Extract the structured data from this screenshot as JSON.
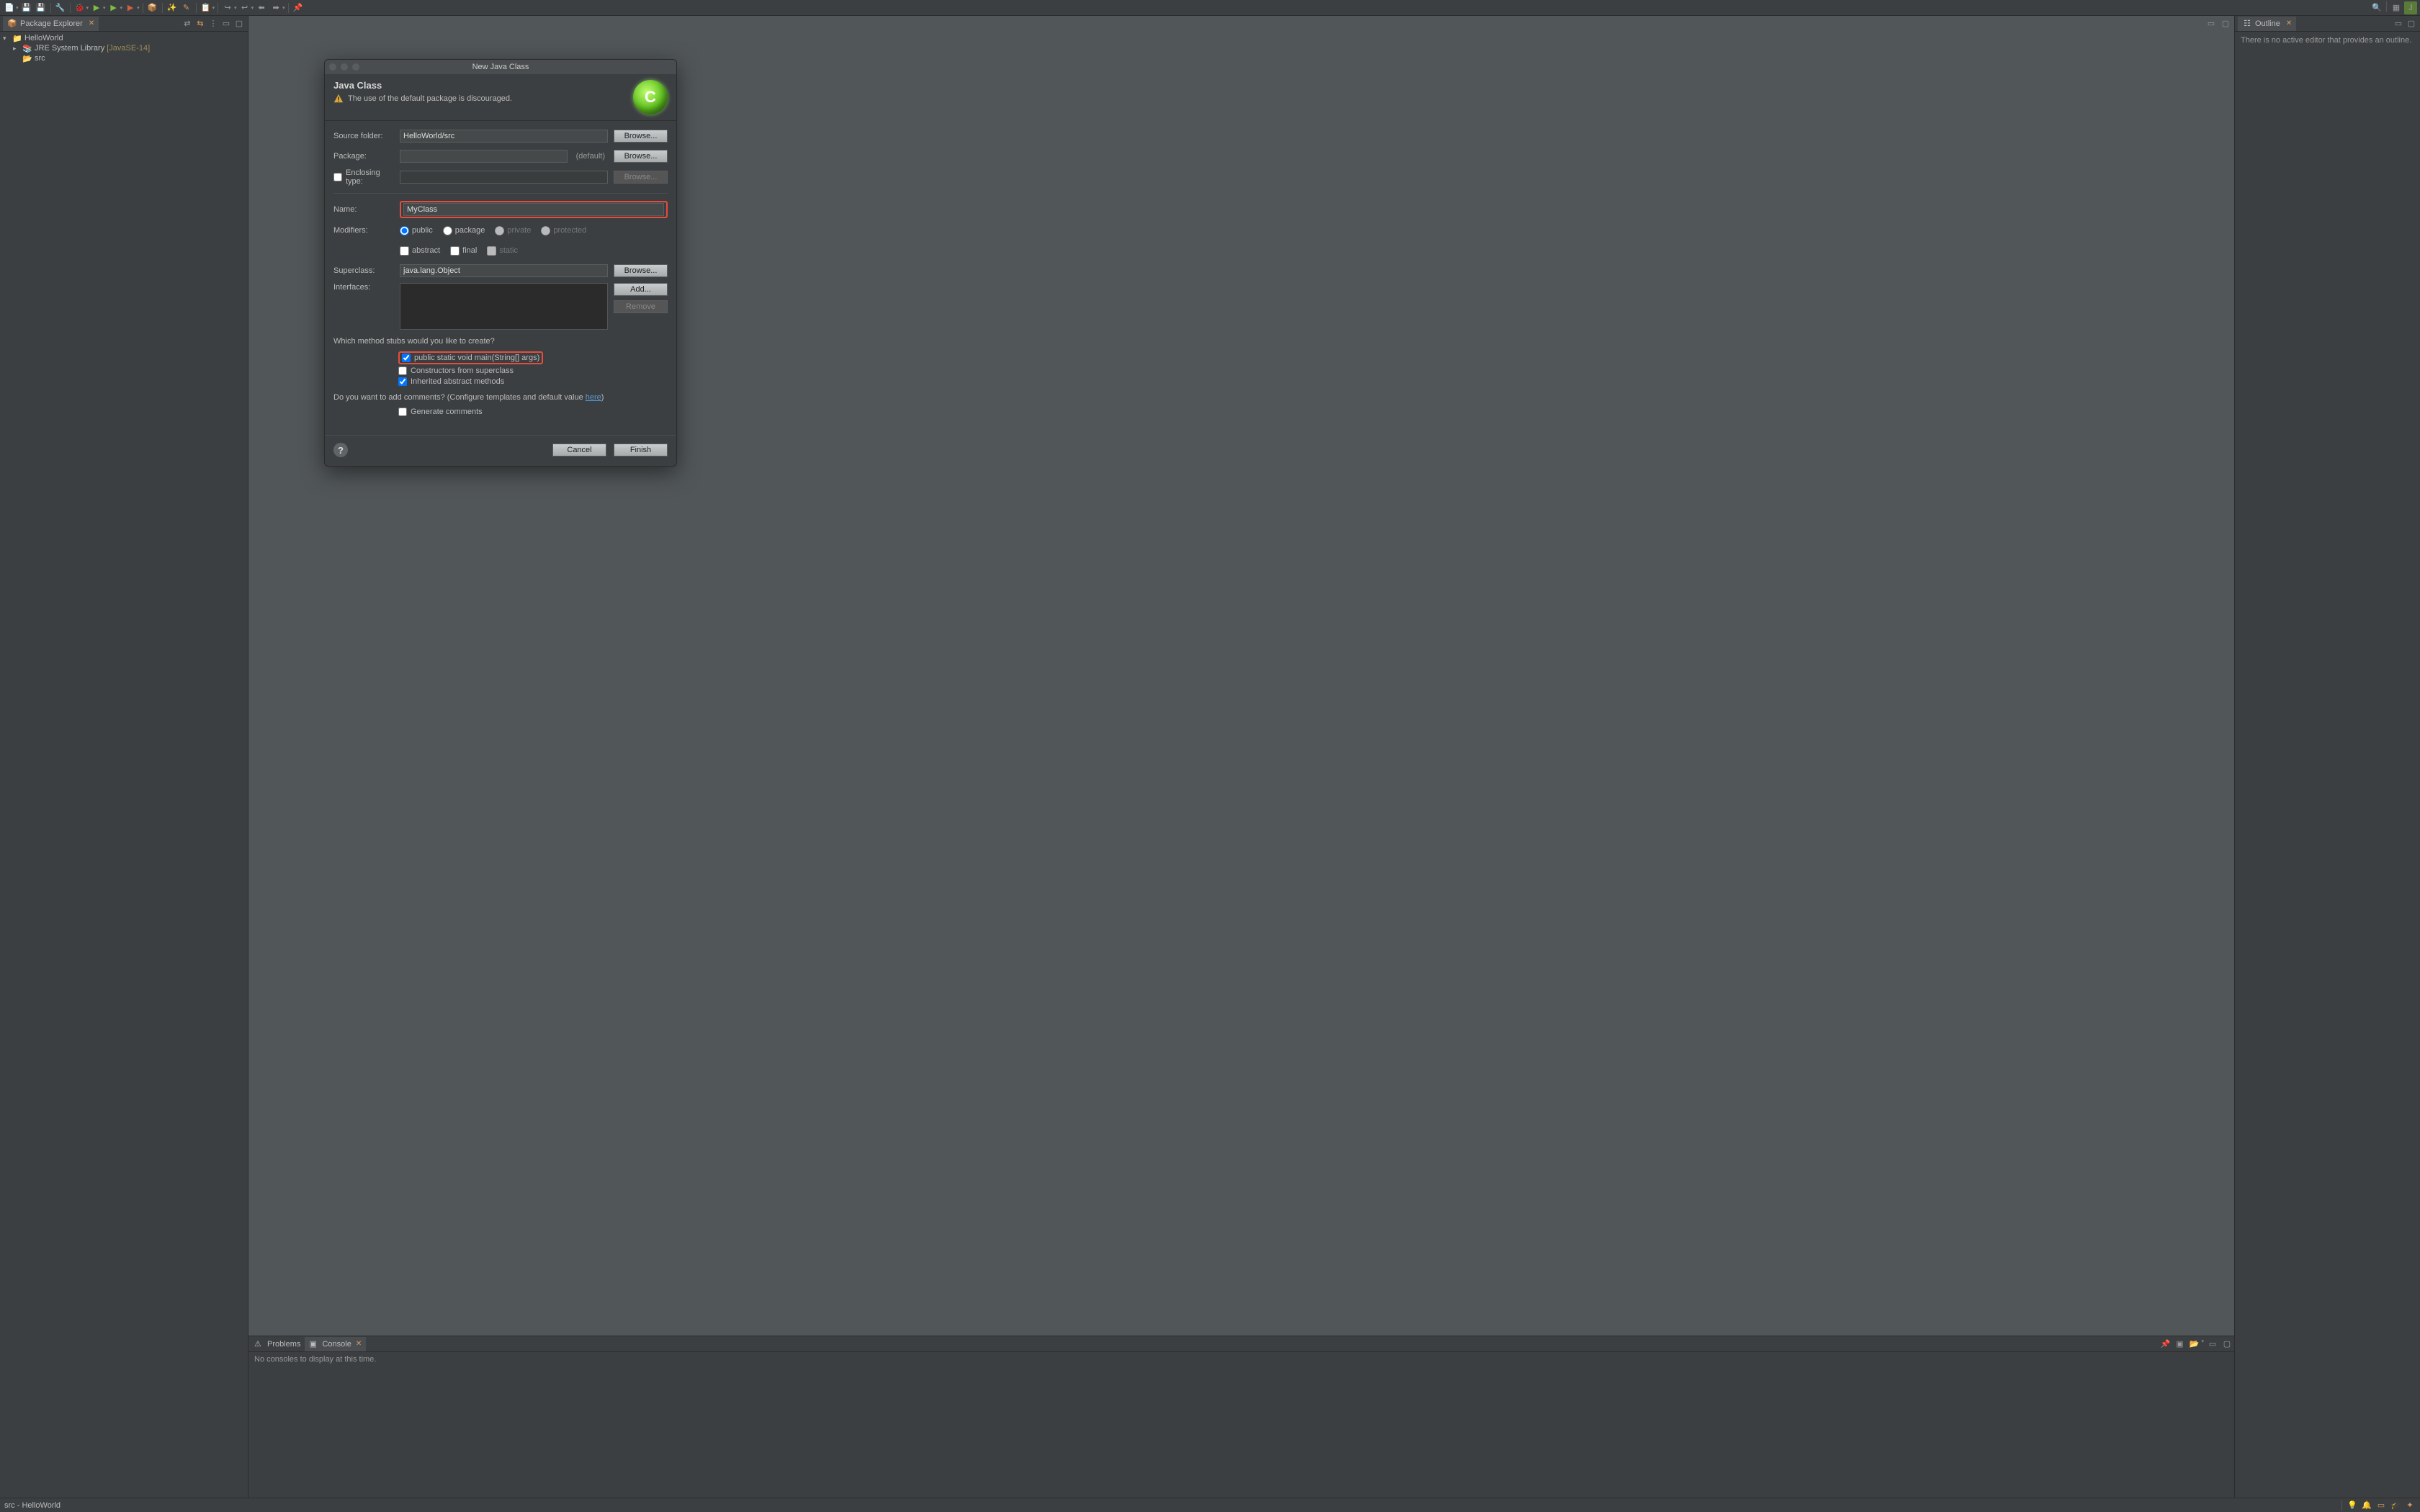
{
  "toolbar": {
    "icons": [
      "new",
      "save",
      "save-all",
      "sep",
      "run-config",
      "sep",
      "run",
      "run-ext",
      "debug",
      "coverage",
      "sep",
      "run-last",
      "sep",
      "wand",
      "pencil",
      "sep",
      "task",
      "sep",
      "nav",
      "nav2",
      "back",
      "forward",
      "sep",
      "open"
    ],
    "right_icons": [
      "search",
      "sep",
      "perspective",
      "java-perspective"
    ]
  },
  "packageExplorer": {
    "title": "Package Explorer",
    "tree": {
      "project": "HelloWorld",
      "jre": "JRE System Library",
      "jre_version": "[JavaSE-14]",
      "src": "src"
    }
  },
  "outline": {
    "title": "Outline",
    "empty_message": "There is no active editor that provides an outline."
  },
  "bottom": {
    "tabs": {
      "problems": "Problems",
      "console": "Console"
    },
    "console_empty": "No consoles to display at this time."
  },
  "status": {
    "text": "src - HelloWorld"
  },
  "dialog": {
    "window_title": "New Java Class",
    "header_title": "Java Class",
    "header_warning": "The use of the default package is discouraged.",
    "labels": {
      "source_folder": "Source folder:",
      "package": "Package:",
      "enclosing_type": "Enclosing type:",
      "name": "Name:",
      "modifiers": "Modifiers:",
      "superclass": "Superclass:",
      "interfaces": "Interfaces:"
    },
    "values": {
      "source_folder": "HelloWorld/src",
      "package": "",
      "package_default": "(default)",
      "enclosing_type": "",
      "name": "MyClass",
      "superclass": "java.lang.Object"
    },
    "buttons": {
      "browse": "Browse...",
      "add": "Add...",
      "remove": "Remove",
      "cancel": "Cancel",
      "finish": "Finish"
    },
    "modifiers": {
      "public": "public",
      "package": "package",
      "private": "private",
      "protected": "protected",
      "abstract": "abstract",
      "final": "final",
      "static": "static"
    },
    "stubs": {
      "question": "Which method stubs would you like to create?",
      "main": "public static void main(String[] args)",
      "constructors": "Constructors from superclass",
      "inherited": "Inherited abstract methods"
    },
    "comments": {
      "question_prefix": "Do you want to add comments? (Configure templates and default value ",
      "here": "here",
      "question_suffix": ")",
      "generate": "Generate comments"
    }
  }
}
